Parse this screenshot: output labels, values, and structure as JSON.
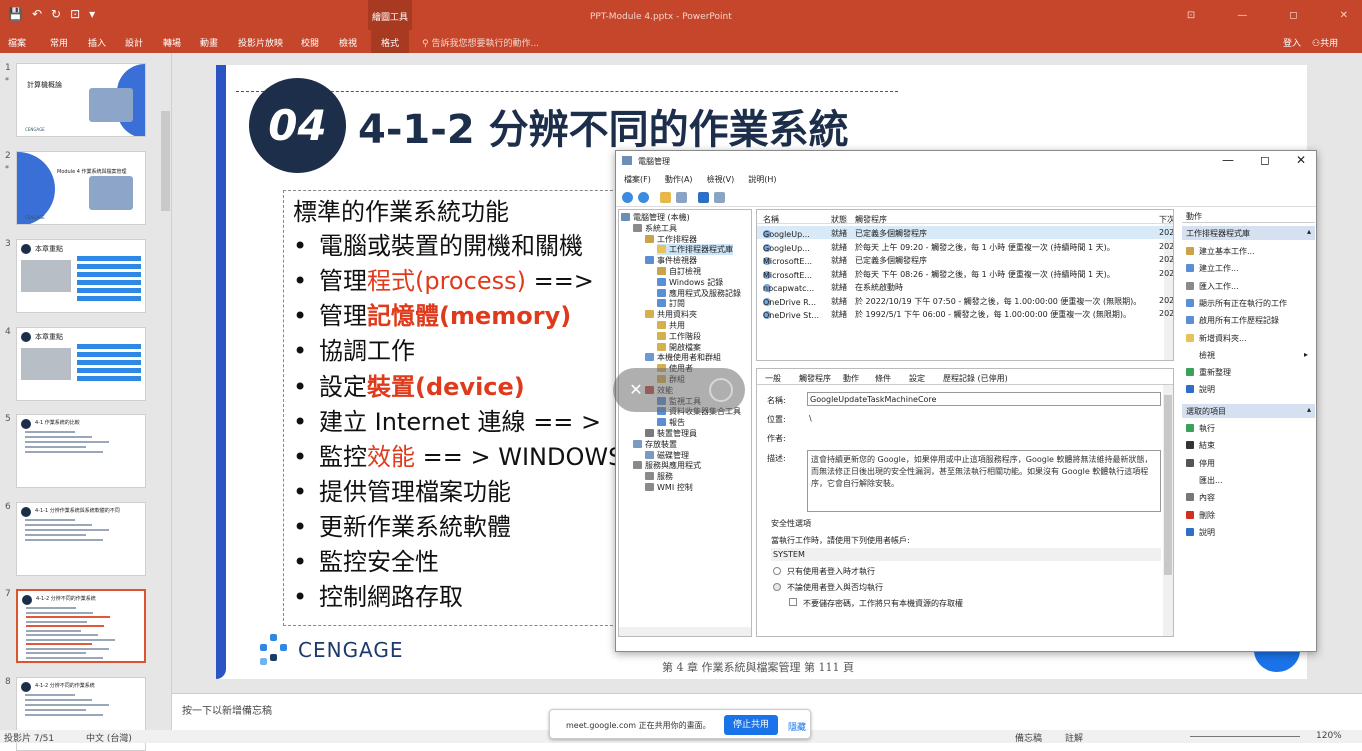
{
  "titlebar": {
    "context_group": "繪圖工具",
    "document_title": "PPT-Module 4.pptx - PowerPoint",
    "qat": [
      "💾",
      "↶",
      "↻",
      "⊡",
      "▾"
    ],
    "window_controls": [
      "⊡",
      "—",
      "◻",
      "✕"
    ]
  },
  "ribbon": {
    "tabs": [
      "檔案",
      "常用",
      "插入",
      "設計",
      "轉場",
      "動畫",
      "投影片放映",
      "校閱",
      "檢視",
      "格式"
    ],
    "active_tab": "格式",
    "tell_me": "告訴我您想要執行的動作...",
    "login": "登入",
    "share": "共用"
  },
  "thumbnails": [
    {
      "num": "1",
      "star": "*",
      "title": "計算機概論",
      "brand": "CENGAGE"
    },
    {
      "num": "2",
      "star": "*",
      "title": "Module 4 作業系統與檔案管理",
      "brand": "CENGAGE"
    },
    {
      "num": "3",
      "star": "",
      "title": "本章重點",
      "brand": ""
    },
    {
      "num": "4",
      "star": "",
      "title": "本章重點",
      "brand": ""
    },
    {
      "num": "5",
      "star": "",
      "title": "4-1 作業系統的比較",
      "brand": ""
    },
    {
      "num": "6",
      "star": "",
      "title": "4-1-1 分辨作業系統與系統軟體的不同",
      "brand": ""
    },
    {
      "num": "7",
      "star": "",
      "title": "4-1-2 分辨不同的作業系統",
      "brand": ""
    },
    {
      "num": "8",
      "star": "",
      "title": "4-1-2 分辨不同的作業系統",
      "brand": ""
    }
  ],
  "selected_slide": "7",
  "slide": {
    "badge": "04",
    "title": "4-1-2 分辨不同的作業系統",
    "heading": "標準的作業系統功能",
    "bullets": [
      {
        "a": "電腦或裝置的開機和關機",
        "b": "",
        "c": ""
      },
      {
        "a": "管理",
        "b": "程式(process)",
        "c": "  ==>"
      },
      {
        "a": "管理",
        "b": "記憶體(memory)",
        "c": ""
      },
      {
        "a": "協調工作",
        "b": "",
        "c": ""
      },
      {
        "a": "設定",
        "b": "裝置(device)",
        "c": ""
      },
      {
        "a": "建立 Internet 連線",
        "b": "",
        "c": "  == >"
      },
      {
        "a": "監控",
        "b": "效能",
        "c": "  == > WINDOWS"
      },
      {
        "a": "提供管理檔案功能",
        "b": "",
        "c": ""
      },
      {
        "a": "更新作業系統軟體",
        "b": "",
        "c": ""
      },
      {
        "a": "監控安全性",
        "b": "",
        "c": ""
      },
      {
        "a": "控制網路存取",
        "b": "",
        "c": ""
      }
    ],
    "brand": "CENGAGE",
    "footer": "第 4 章  作業系統與檔案管理  第 111 頁"
  },
  "notes_placeholder": "按一下以新增備忘稿",
  "status": {
    "slide_of": "投影片 7/51",
    "language": "中文 (台灣)",
    "notes": "備忘稿",
    "comments": "註解",
    "zoom": "120%"
  },
  "meet": {
    "message": "meet.google.com 正在共用你的畫面。",
    "stop": "停止共用",
    "hide": "隱藏"
  },
  "computer_mgmt": {
    "title": "電腦管理",
    "menu": [
      "檔案(F)",
      "動作(A)",
      "檢視(V)",
      "說明(H)"
    ],
    "tree": [
      {
        "label": "電腦管理 (本機)",
        "level": 0,
        "sel": false
      },
      {
        "label": "系統工具",
        "level": 1,
        "sel": false
      },
      {
        "label": "工作排程器",
        "level": 2,
        "sel": false
      },
      {
        "label": "工作排程器程式庫",
        "level": 3,
        "sel": true
      },
      {
        "label": "事件檢視器",
        "level": 2,
        "sel": false
      },
      {
        "label": "自訂檢視",
        "level": 3,
        "sel": false
      },
      {
        "label": "Windows 記錄",
        "level": 3,
        "sel": false
      },
      {
        "label": "應用程式及服務記錄",
        "level": 3,
        "sel": false
      },
      {
        "label": "訂閱",
        "level": 3,
        "sel": false
      },
      {
        "label": "共用資料夾",
        "level": 2,
        "sel": false
      },
      {
        "label": "共用",
        "level": 3,
        "sel": false
      },
      {
        "label": "工作階段",
        "level": 3,
        "sel": false
      },
      {
        "label": "開啟檔案",
        "level": 3,
        "sel": false
      },
      {
        "label": "本機使用者和群組",
        "level": 2,
        "sel": false
      },
      {
        "label": "使用者",
        "level": 3,
        "sel": false
      },
      {
        "label": "群組",
        "level": 3,
        "sel": false
      },
      {
        "label": "效能",
        "level": 2,
        "sel": false
      },
      {
        "label": "監視工具",
        "level": 3,
        "sel": false
      },
      {
        "label": "資料收集器集合工具",
        "level": 3,
        "sel": false
      },
      {
        "label": "報告",
        "level": 3,
        "sel": false
      },
      {
        "label": "裝置管理員",
        "level": 2,
        "sel": false
      },
      {
        "label": "存放裝置",
        "level": 1,
        "sel": false
      },
      {
        "label": "磁碟管理",
        "level": 2,
        "sel": false
      },
      {
        "label": "服務與應用程式",
        "level": 1,
        "sel": false
      },
      {
        "label": "服務",
        "level": 2,
        "sel": false
      },
      {
        "label": "WMI 控制",
        "level": 2,
        "sel": false
      }
    ],
    "task_headers": [
      "名稱",
      "狀態",
      "觸發程序",
      "下次"
    ],
    "tasks": [
      {
        "name": "GoogleUp...",
        "status": "就緒",
        "trigger": "已定義多個觸發程序",
        "next": "202",
        "sel": true
      },
      {
        "name": "GoogleUp...",
        "status": "就緒",
        "trigger": "於每天 上午 09:20 - 觸發之後，每 1 小時 便重複一次 (持續時間 1 天)。",
        "next": "202",
        "sel": false
      },
      {
        "name": "MicrosoftE...",
        "status": "就緒",
        "trigger": "已定義多個觸發程序",
        "next": "202",
        "sel": false
      },
      {
        "name": "MicrosoftE...",
        "status": "就緒",
        "trigger": "於每天 下午 08:26 - 觸發之後，每 1 小時 便重複一次 (持續時間 1 天)。",
        "next": "202",
        "sel": false
      },
      {
        "name": "npcapwatc...",
        "status": "就緒",
        "trigger": "在系統啟動時",
        "next": "",
        "sel": false
      },
      {
        "name": "OneDrive R...",
        "status": "就緒",
        "trigger": "於 2022/10/19 下午 07:50 - 觸發之後，每 1.00:00:00 便重複一次 (無限期)。",
        "next": "202",
        "sel": false
      },
      {
        "name": "OneDrive St...",
        "status": "就緒",
        "trigger": "於 1992/5/1 下午 06:00 - 觸發之後，每 1.00:00:00 便重複一次 (無限期)。",
        "next": "202",
        "sel": false
      }
    ],
    "detail_tabs": [
      "一般",
      "觸發程序",
      "動作",
      "條件",
      "設定",
      "歷程記錄 (已停用)"
    ],
    "name_label": "名稱:",
    "name_value": "GoogleUpdateTaskMachineCore",
    "location_label": "位置:",
    "location_value": "\\",
    "author_label": "作者:",
    "desc_label": "描述:",
    "description": "這會持續更新您的 Google，如果停用或中止這項服務程序，Google 軟體將無法維持最新狀態，而無法修正日後出現的安全性漏洞，甚至無法執行相關功能。如果沒有 Google 軟體執行這項程序，它會自行解除安裝。",
    "security_title": "安全性選項",
    "run_as_label": "當執行工作時，請使用下列使用者帳戶:",
    "run_as_value": "SYSTEM",
    "radio1": "只有使用者登入時才執行",
    "radio2": "不論使用者登入與否均執行",
    "checkbox1": "不要儲存密碼，工作將只有本機資源的存取權",
    "action_header": "動作",
    "section1": "工作排程器程式庫",
    "actions1": [
      "建立基本工作...",
      "建立工作...",
      "匯入工作...",
      "顯示所有正在執行的工作",
      "啟用所有工作歷程記錄",
      "新增資料夾...",
      "檢視",
      "重新整理",
      "說明"
    ],
    "section2": "選取的項目",
    "actions2": [
      "執行",
      "結束",
      "停用",
      "匯出...",
      "內容",
      "刪除",
      "說明"
    ]
  }
}
